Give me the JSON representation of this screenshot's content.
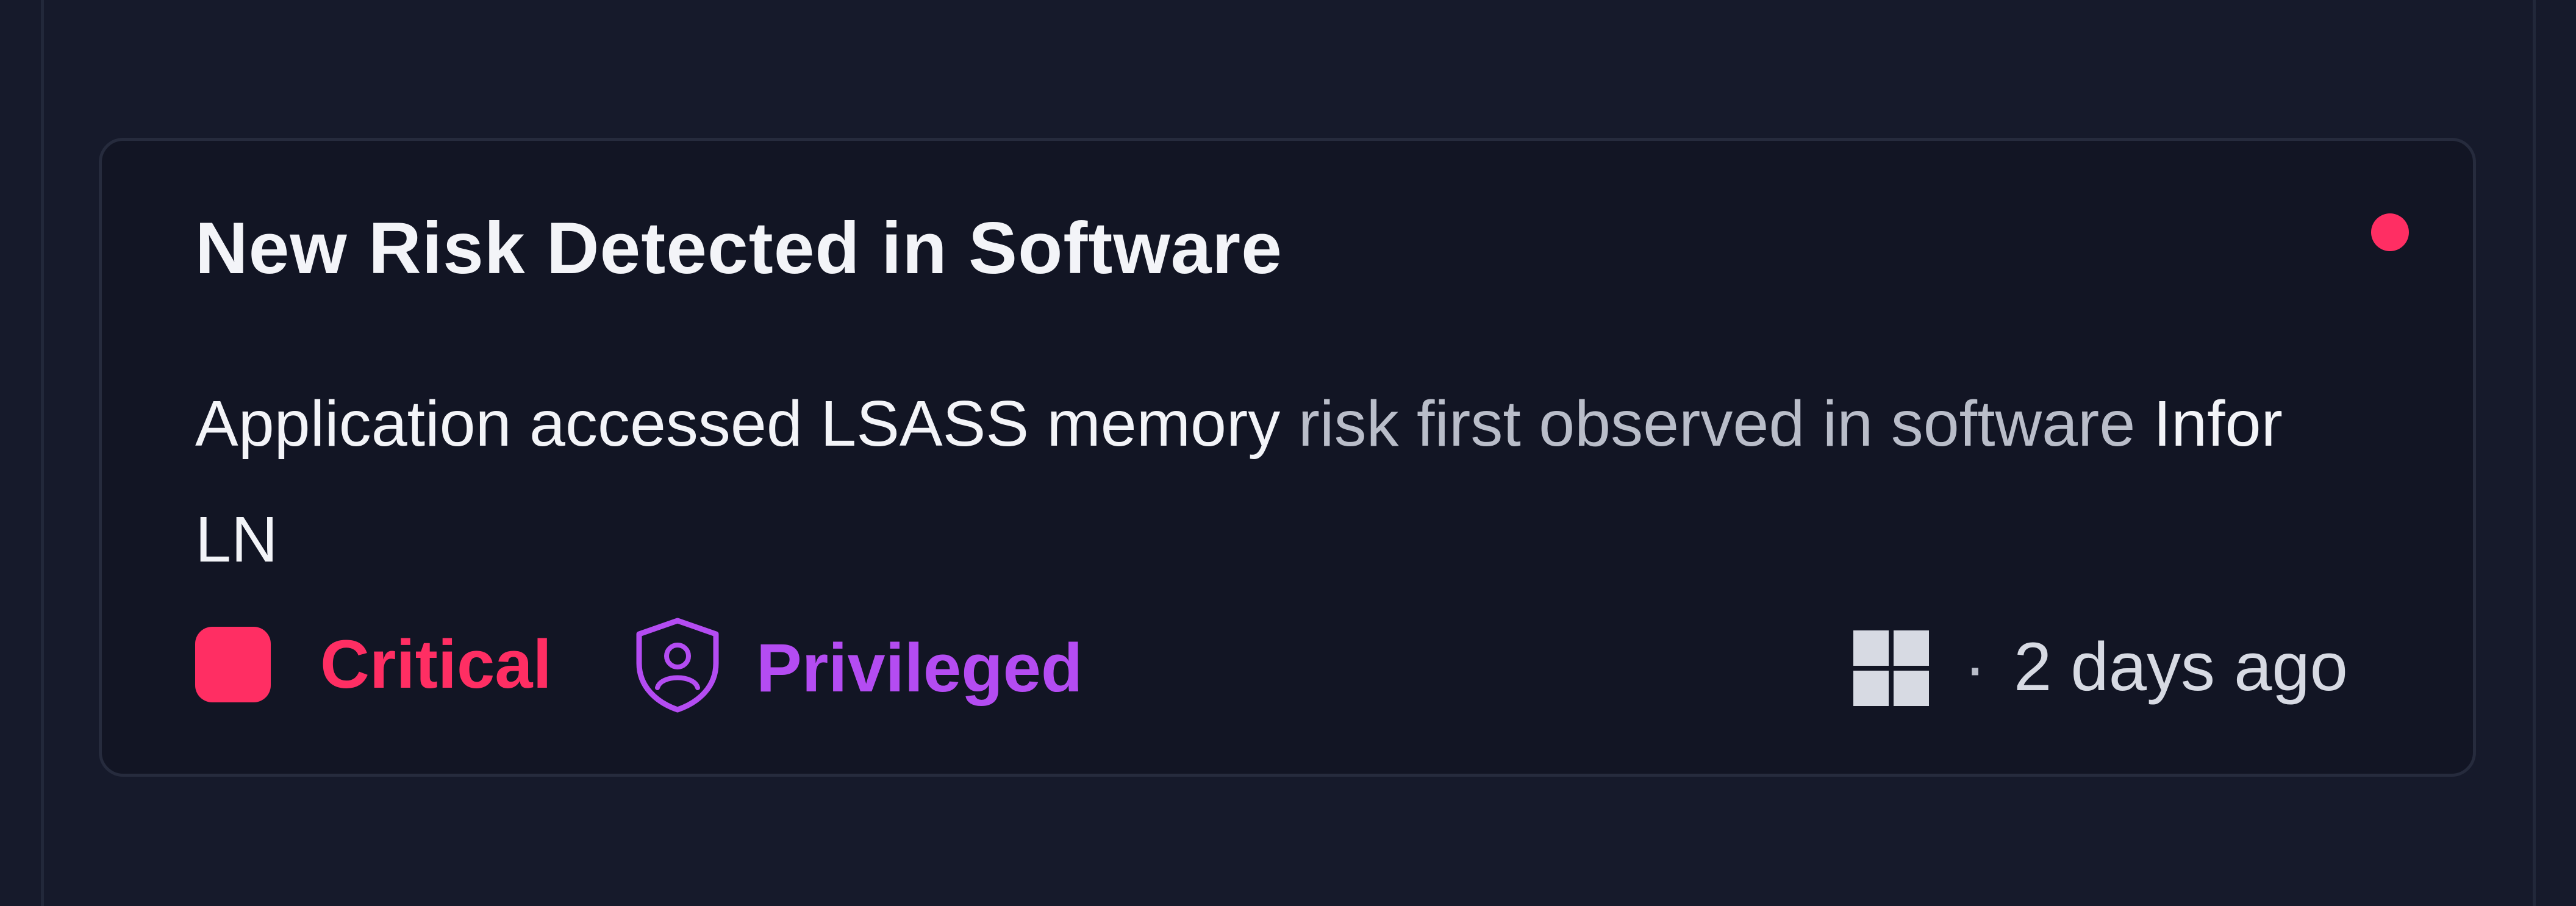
{
  "notification": {
    "title": "New Risk Detected in Software",
    "unread": true,
    "message": {
      "risk_name": "Application accessed LSASS memory",
      "middle_text": "risk first observed in software",
      "software_name": "Infor LN"
    },
    "severity": {
      "label": "Critical",
      "color": "#ff2e63"
    },
    "privilege": {
      "label": "Privileged",
      "icon": "shield-user-icon",
      "color": "#b44cf2"
    },
    "platform": {
      "icon": "windows-icon"
    },
    "separator": "·",
    "timestamp": "2 days ago"
  },
  "colors": {
    "background": "#161a2b",
    "card_background": "#121524",
    "card_border": "#262b3d",
    "title": "#f3f4f8",
    "muted_text": "#b9bdc9"
  }
}
